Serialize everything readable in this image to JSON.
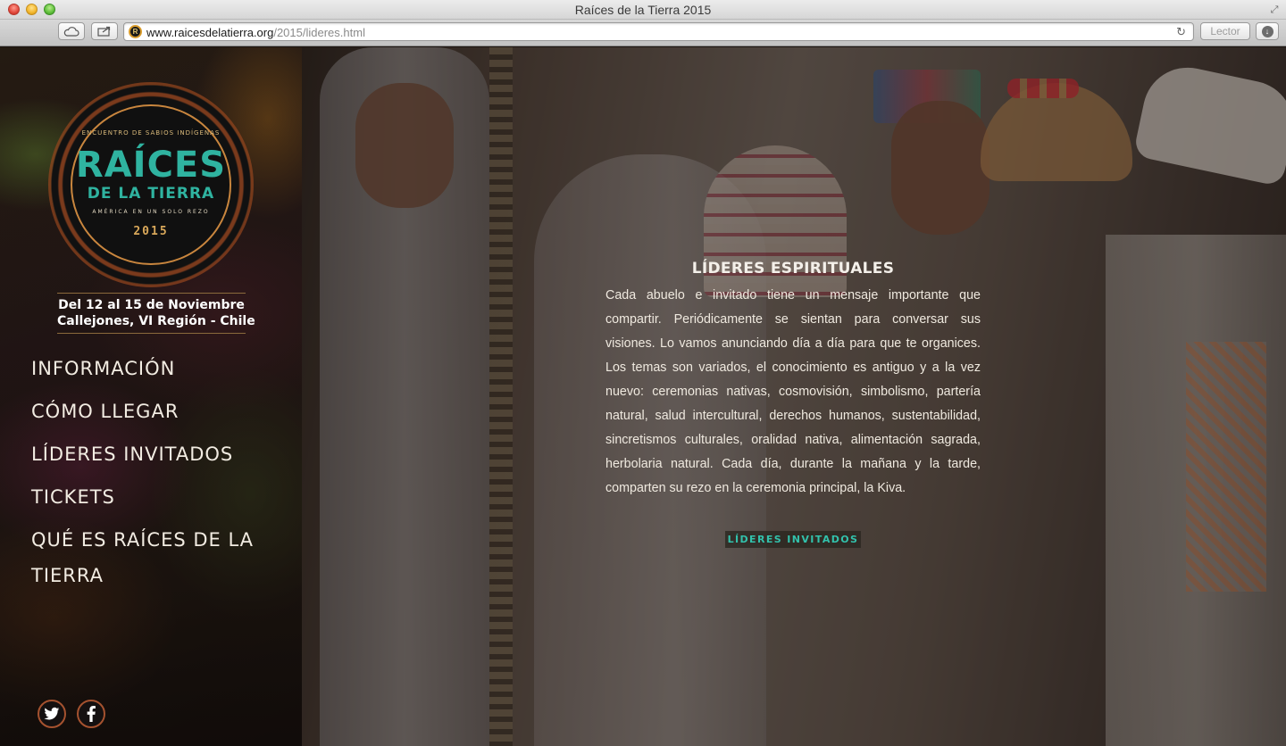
{
  "browser": {
    "window_title": "Raíces de la Tierra 2015",
    "url_host": "www.raicesdelatierra.org",
    "url_path": "/2015/lideres.html",
    "reader_label": "Lector",
    "back_icon": "chevron-left-icon",
    "forward_icon": "chevron-right-icon"
  },
  "logo": {
    "tagline": "ENCUENTRO DE SABIOS INDÍGENAS",
    "title_line1": "RAÍCES",
    "title_line2": "DE LA TIERRA",
    "subtitle": "AMÉRICA EN UN SOLO REZO",
    "year": "2015",
    "colors": {
      "teal": "#2fb3a0",
      "gold": "#d9a85a",
      "rim": "#8d4a22"
    }
  },
  "event": {
    "dates": "Del 12 al 15 de Noviembre",
    "location": "Callejones, VI Región - Chile"
  },
  "nav": [
    {
      "label": "INFORMACIÓN"
    },
    {
      "label": "CÓMO LLEGAR"
    },
    {
      "label": "LÍDERES INVITADOS"
    },
    {
      "label": "TICKETS"
    },
    {
      "label": "QUÉ ES RAÍCES DE LA TIERRA"
    }
  ],
  "social": {
    "twitter_icon": "twitter-icon",
    "facebook_icon": "facebook-icon"
  },
  "main": {
    "heading": "LÍDERES ESPIRITUALES",
    "body": "Cada abuelo e invitado tiene un mensaje importante que compartir. Periódicamente se sientan para conversar sus visiones. Lo vamos anunciando día a día para que te organices. Los temas son variados, el conocimiento es antiguo y a la vez nuevo: ceremonias nativas, cosmovisión, simbolismo, partería natural, salud intercultural, derechos humanos, sustentabilidad, sincretismos culturales, oralidad nativa, alimentación sagrada, herbolaria natural. Cada día, durante la mañana y la tarde, comparten su rezo en la ceremonia principal, la Kiva.",
    "cta_label": "LÍDERES INVITADOS",
    "accent": "#32c2ac"
  }
}
